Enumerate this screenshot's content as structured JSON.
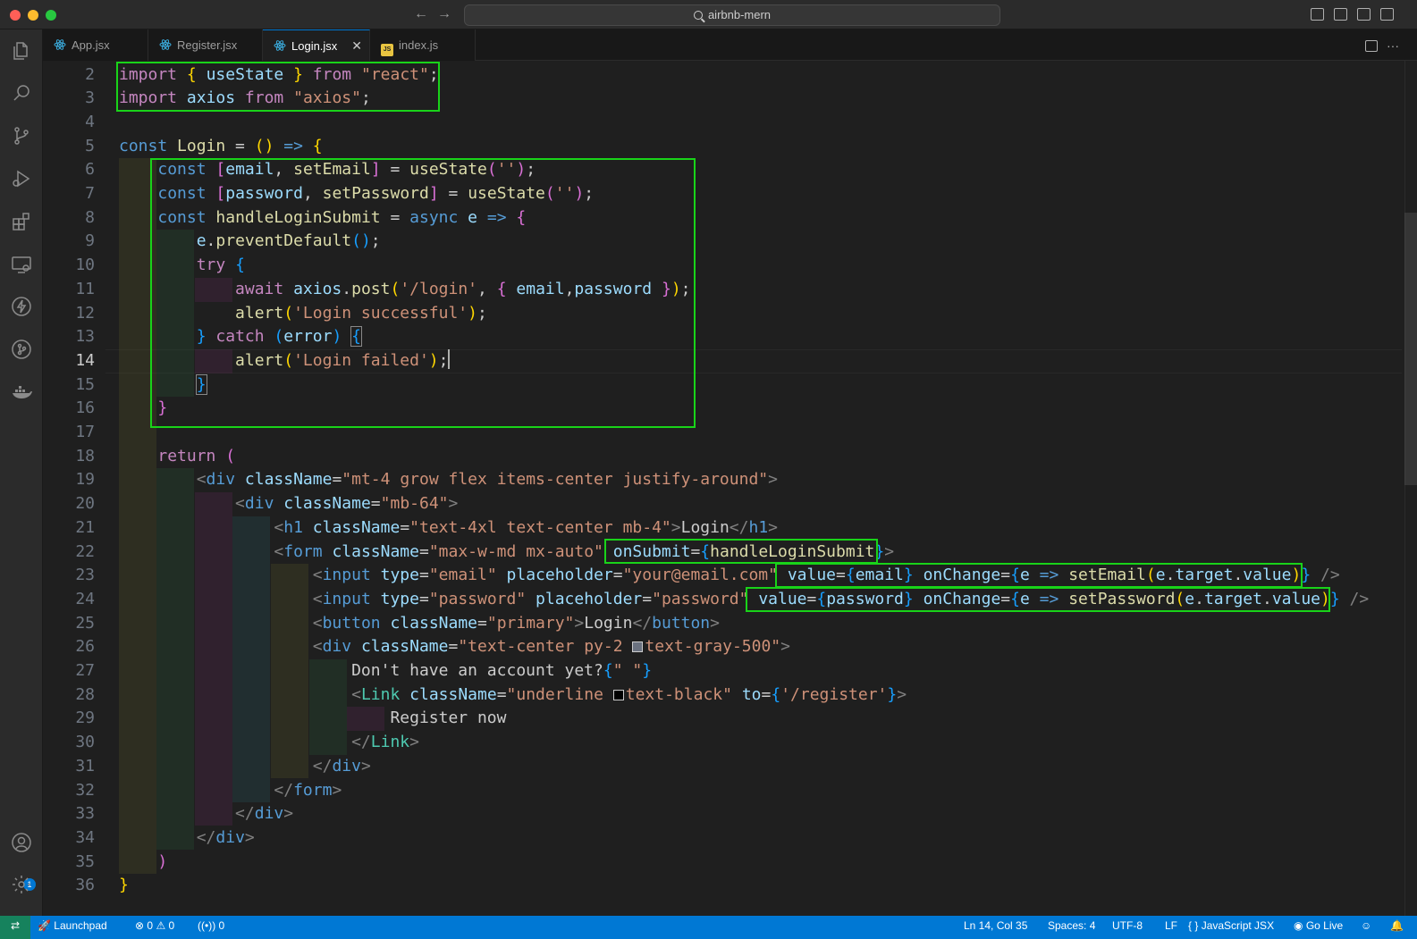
{
  "window": {
    "title": "airbnb-mern"
  },
  "tabs": [
    {
      "label": "App.jsx",
      "icon": "react-icon"
    },
    {
      "label": "Register.jsx",
      "icon": "react-icon"
    },
    {
      "label": "Login.jsx",
      "icon": "react-icon",
      "active": true
    },
    {
      "label": "index.js",
      "icon": "js-icon"
    }
  ],
  "editor": {
    "cursor": {
      "line": 14,
      "col": 35
    },
    "line_numbers": [
      "2",
      "3",
      "4",
      "5",
      "6",
      "7",
      "8",
      "9",
      "10",
      "11",
      "12",
      "13",
      "14",
      "15",
      "16",
      "17",
      "18",
      "19",
      "20",
      "21",
      "22",
      "23",
      "24",
      "25",
      "26",
      "27",
      "28",
      "29",
      "30",
      "31",
      "32",
      "33",
      "34",
      "35",
      "36"
    ],
    "tokens": {
      "import": "import",
      "from": "from",
      "useState": "useState",
      "react_str": "\"react\"",
      "axios": "axios",
      "axios_str": "\"axios\"",
      "const": "const",
      "Login": "Login",
      "email": "email",
      "setEmail": "setEmail",
      "password": "password",
      "setPassword": "setPassword",
      "empty_str": "''",
      "handleLoginSubmit": "handleLoginSubmit",
      "async": "async",
      "e": "e",
      "preventDefault": "preventDefault",
      "try": "try",
      "await": "await",
      "post": "post",
      "login_path": "'/login'",
      "alert": "alert",
      "login_success": "'Login successful'",
      "catch": "catch",
      "error": "error",
      "login_failed": "'Login failed'",
      "return": "return",
      "div": "div",
      "className": "className",
      "cls_main": "\"mt-4 grow flex items-center justify-around\"",
      "cls_mb64": "\"mb-64\"",
      "h1": "h1",
      "cls_h1": "\"text-4xl text-center mb-4\"",
      "login_text": "Login",
      "form": "form",
      "cls_form": "\"max-w-md mx-auto\"",
      "onSubmit": "onSubmit",
      "input": "input",
      "type": "type",
      "placeholder": "placeholder",
      "type_email": "\"email\"",
      "ph_email": "\"your@email.com\"",
      "value": "value",
      "onChange": "onChange",
      "target": "target",
      "type_password": "\"password\"",
      "ph_password": "\"password\"",
      "button": "button",
      "cls_primary": "\"primary\"",
      "cls_div_a": "\"text-center py-2 ",
      "cls_div_b": "text-gray-500\"",
      "no_account": "Don't have an account yet?",
      "space_str": "\" \"",
      "Link": "Link",
      "cls_link_a": "\"underline ",
      "cls_link_b": "text-black\"",
      "to": "to",
      "register_path": "'/register'",
      "register_now": "Register now"
    }
  },
  "statusbar": {
    "remote_icon": "remote-icon",
    "launchpad": "Launchpad",
    "errors": "0",
    "warnings": "0",
    "ports": "0",
    "position": "Ln 14, Col 35",
    "spaces": "Spaces: 4",
    "encoding": "UTF-8",
    "eol": "LF",
    "language": "JavaScript JSX",
    "golive": "Go Live"
  },
  "activitybar": {
    "icons": [
      "files-icon",
      "search-icon",
      "source-control-icon",
      "run-debug-icon",
      "extensions-icon",
      "remote-explorer-icon",
      "thunder-client-icon",
      "git-graph-icon",
      "docker-icon",
      "account-icon",
      "settings-icon"
    ],
    "account_badge": "1"
  },
  "colors": {
    "accent": "#0078d4",
    "highlight_box": "#19d319",
    "remote": "#16825d"
  }
}
